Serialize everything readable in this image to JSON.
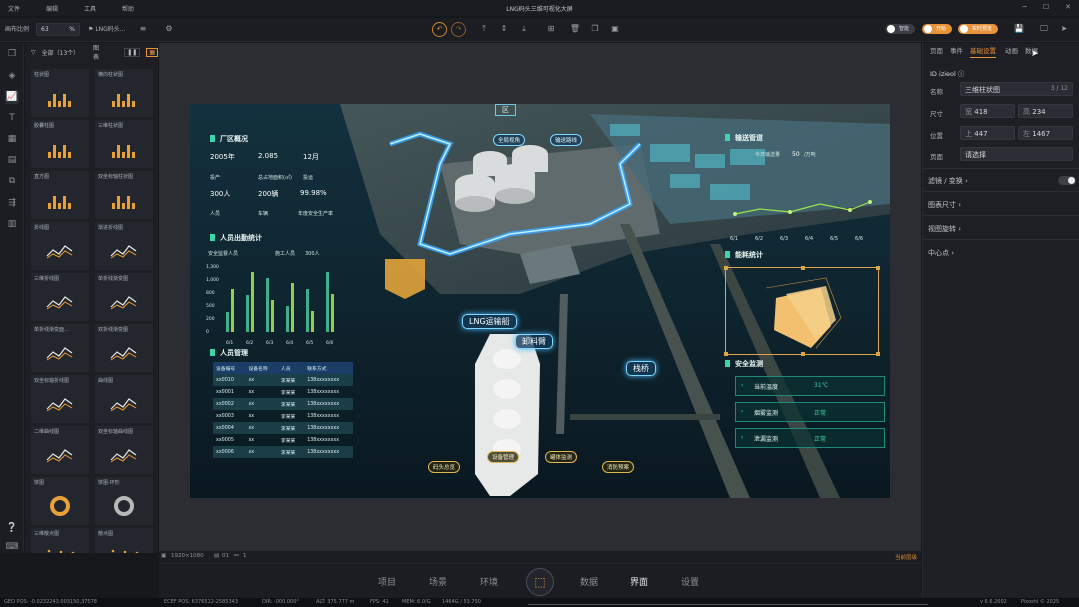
{
  "menu": {
    "items": [
      "文件",
      "编辑",
      "工具",
      "帮助"
    ],
    "title": "LNG码头三维可视化大屏"
  },
  "toolbar": {
    "canvas_ratio_label": "画布比例",
    "canvas_ratio_value": "63",
    "canvas_ratio_unit": "%",
    "project_name": "LNG码头...",
    "toggle1_label": "智能",
    "toggle2_label": "开始",
    "toggle3_label": "实时预览"
  },
  "library": {
    "filter_label": "全部（13个）",
    "chart_label": "图表",
    "items": [
      {
        "label": "柱状图"
      },
      {
        "label": "横向柱状图"
      },
      {
        "label": "胶囊柱图"
      },
      {
        "label": "三维柱状图"
      },
      {
        "label": "直方图"
      },
      {
        "label": "双坐标轴柱状图"
      },
      {
        "label": "折线图"
      },
      {
        "label": "渐进折线图"
      },
      {
        "label": "三维折线图"
      },
      {
        "label": "单折线渐变图"
      },
      {
        "label": "单折线渐变面..."
      },
      {
        "label": "双折线渐变图"
      },
      {
        "label": "双坐标轴折线图"
      },
      {
        "label": "曲线图"
      },
      {
        "label": "二维曲线图"
      },
      {
        "label": "双坐标轴曲线图"
      },
      {
        "label": "饼图"
      },
      {
        "label": "饼图-环形"
      },
      {
        "label": "三维散点图"
      },
      {
        "label": "散点图"
      }
    ]
  },
  "dashboard": {
    "top_label": "区",
    "plant": {
      "title": "厂区概况",
      "v1": "2005年",
      "v2": "2.085",
      "v3": "12月",
      "s1": "投产",
      "s2": "总占地面积(㎡)",
      "s3": "投运",
      "v4": "300人",
      "v5": "200辆",
      "v6": "99.98%",
      "s4": "人员",
      "s5": "车辆",
      "s6": "年度安全生产率"
    },
    "attendance": {
      "title": "人员出勤统计",
      "legend1": "安全监督人员",
      "legend2": "施工人员",
      "count": "300人",
      "y": [
        "1,300",
        "1,000",
        "800",
        "500",
        "200",
        "0"
      ],
      "x": [
        "6/1",
        "6/2",
        "6/3",
        "6/4",
        "6/5",
        "6/6"
      ]
    },
    "people": {
      "title": "人员管理",
      "headers": [
        "设备编号",
        "设备名称",
        "人员",
        "联系方式"
      ],
      "rows": [
        [
          "xx0010",
          "xx",
          "李某某",
          "138xxxxxxxx"
        ],
        [
          "xx0001",
          "xx",
          "李某某",
          "138xxxxxxxx"
        ],
        [
          "xx0002",
          "xx",
          "李某某",
          "138xxxxxxxx"
        ],
        [
          "xx0003",
          "xx",
          "李某某",
          "138xxxxxxxx"
        ],
        [
          "xx0004",
          "xx",
          "李某某",
          "138xxxxxxxx"
        ],
        [
          "xx0005",
          "xx",
          "李某某",
          "138xxxxxxxx"
        ],
        [
          "xx0006",
          "xx",
          "李某某",
          "138xxxxxxxx"
        ]
      ]
    },
    "pipeline": {
      "title": "输送管道",
      "sub": "今日输送量",
      "value": "50",
      "unit": "/万吨",
      "x": [
        "6/1",
        "6/2",
        "6/3",
        "6/4",
        "6/5",
        "6/6"
      ]
    },
    "energy": {
      "title": "能耗统计"
    },
    "safety": {
      "title": "安全监测",
      "rows": [
        {
          "label": "当前温度",
          "value": "31℃"
        },
        {
          "label": "烟雾监测",
          "value": "正常"
        },
        {
          "label": "泄漏监测",
          "value": "正常"
        }
      ]
    },
    "pois": {
      "ship": "LNG运输船",
      "arm": "卸料臂",
      "bridge": "栈桥",
      "route1": "全局视角",
      "route2": "输送路线",
      "small": [
        "码头总览",
        "设备管理",
        "罐体监测",
        "消防预案"
      ]
    }
  },
  "status": {
    "size": "1920×1080",
    "layers": "01",
    "nodes": "1",
    "right": "当前层级"
  },
  "bottom": {
    "tabs": [
      "项目",
      "场景",
      "环境",
      "数据",
      "界面",
      "设置"
    ]
  },
  "info": {
    "geo": "GEO POS: -0.0232243.003150,37578",
    "ecef": "ECEF POS: 6376512-2585343",
    "dir": "DIR: -000.000°",
    "alt": "ALT: 375.777 m",
    "fps": "FPS: 41",
    "mem": "MEM: 6.0/G",
    "mem2": "1464G / 53.750",
    "ver": "v 6.6.2002",
    "copy": "Pixoshi © 2025"
  },
  "props": {
    "tabs": [
      "页面",
      "事件",
      "基础设置",
      "动画",
      "数据"
    ],
    "active_tab": 2,
    "id_label": "ID",
    "id_value": "izieol",
    "name_label": "名称",
    "name_value": "三维柱状图",
    "name_count": "3 / 12",
    "size_label": "尺寸",
    "w_label": "宽",
    "w_value": "418",
    "h_label": "高",
    "h_value": "234",
    "pos_label": "位置",
    "top_label": "上",
    "top_value": "447",
    "left_label": "左",
    "left_value": "1467",
    "page_label": "页面",
    "page_value": "请选择",
    "sec1": "滤镜 / 变换",
    "sec2": "图表尺寸",
    "sec3": "视图旋转",
    "sec4": "中心点"
  }
}
